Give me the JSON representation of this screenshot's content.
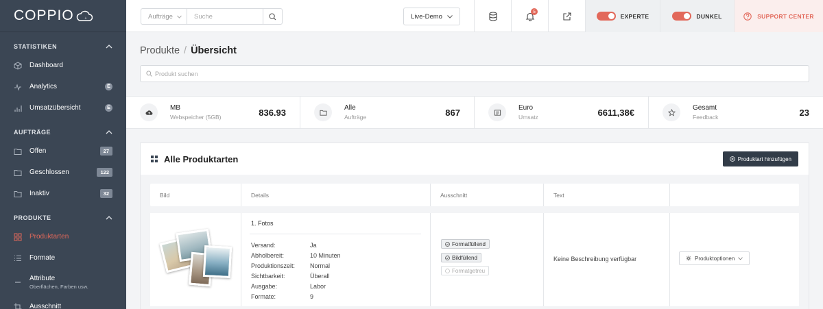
{
  "app": {
    "logo": "COPPIO"
  },
  "sidebar": {
    "sections": [
      {
        "title": "STATISTIKEN",
        "items": [
          {
            "label": "Dashboard",
            "icon": "cube-icon",
            "badge": ""
          },
          {
            "label": "Analytics",
            "icon": "activity-icon",
            "badge": "E"
          },
          {
            "label": "Umsatzübersicht",
            "icon": "bar-chart-icon",
            "badge": "E"
          }
        ]
      },
      {
        "title": "AUFTRÄGE",
        "items": [
          {
            "label": "Offen",
            "icon": "folder-icon",
            "badge": "27"
          },
          {
            "label": "Geschlossen",
            "icon": "folder-icon",
            "badge": "122"
          },
          {
            "label": "Inaktiv",
            "icon": "folder-icon",
            "badge": "32"
          }
        ]
      },
      {
        "title": "PRODUKTE",
        "items": [
          {
            "label": "Produktarten",
            "icon": "grid-icon",
            "badge": ""
          },
          {
            "label": "Formate",
            "icon": "list-icon",
            "badge": ""
          },
          {
            "label": "Attribute",
            "sublabel": "Oberflächen, Farben usw.",
            "icon": "minus-icon",
            "badge": ""
          },
          {
            "label": "Ausschnitt",
            "icon": "crop-icon",
            "badge": ""
          }
        ]
      }
    ]
  },
  "topbar": {
    "search_select": "Aufträge",
    "search_placeholder": "Suche",
    "env_select": "Live-Demo",
    "notifications_count": "5",
    "toggle_expert": "EXPERTE",
    "toggle_dark": "DUNKEL",
    "support": "SUPPORT CENTER"
  },
  "breadcrumb": {
    "parent": "Produkte",
    "separator": "/",
    "current": "Übersicht"
  },
  "product_search_placeholder": "Produkt suchen",
  "stats": [
    {
      "title": "MB",
      "subtitle": "Webspeicher (5GB)",
      "value": "836.93",
      "icon": "cloud-upload-icon"
    },
    {
      "title": "Alle",
      "subtitle": "Aufträge",
      "value": "867",
      "icon": "folder-icon"
    },
    {
      "title": "Euro",
      "subtitle": "Umsatz",
      "value": "6611,38€",
      "icon": "receipt-icon"
    },
    {
      "title": "Gesamt",
      "subtitle": "Feedback",
      "value": "23",
      "icon": "star-icon"
    }
  ],
  "panel": {
    "title": "Alle Produktarten",
    "add_button": "Produktart hinzufügen",
    "columns": [
      "Bild",
      "Details",
      "Ausschnitt",
      "Text",
      ""
    ],
    "row": {
      "title": "1. Fotos",
      "details": [
        {
          "k": "Versand:",
          "v": "Ja"
        },
        {
          "k": "Abholbereit:",
          "v": "10 Minuten"
        },
        {
          "k": "Produktionszeit:",
          "v": "Normal"
        },
        {
          "k": "Sichtbarkeit:",
          "v": "Überall"
        },
        {
          "k": "Ausgabe:",
          "v": "Labor"
        },
        {
          "k": "Formate:",
          "v": "9"
        }
      ],
      "tags": [
        {
          "label": "Formatfüllend",
          "active": true
        },
        {
          "label": "Bildfüllend",
          "active": true
        },
        {
          "label": "Formatgetreu",
          "active": false
        }
      ],
      "text": "Keine Beschreibung verfügbar",
      "options_button": "Produktoptionen"
    }
  },
  "colors": {
    "sidebar": "#3b4654",
    "accent": "#e2685a",
    "dark_button": "#323c48"
  }
}
